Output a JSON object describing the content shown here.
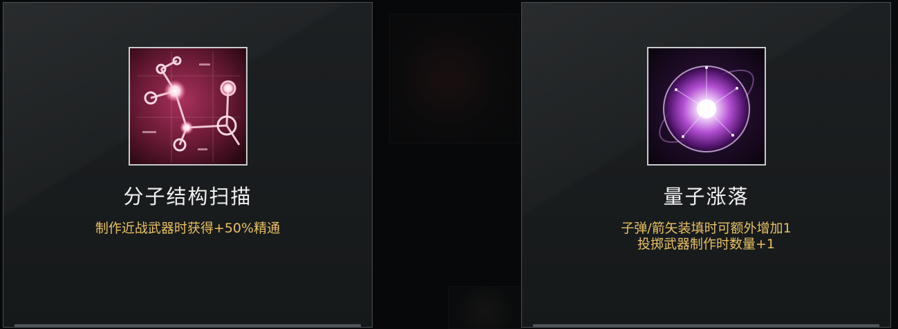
{
  "cards": [
    {
      "title": "分子结构扫描",
      "desc_lines": [
        "制作近战武器时获得+50%精通"
      ],
      "icon": "molecule-icon"
    },
    {
      "title": "量子涨落",
      "desc_lines": [
        "子弹/箭矢装填时可额外增加1",
        "投掷武器制作时数量+1"
      ],
      "icon": "quantum-orb-icon"
    }
  ],
  "colors": {
    "title": "#f2f2f2",
    "description": "#e8c062",
    "card_border": "#4a5256"
  }
}
